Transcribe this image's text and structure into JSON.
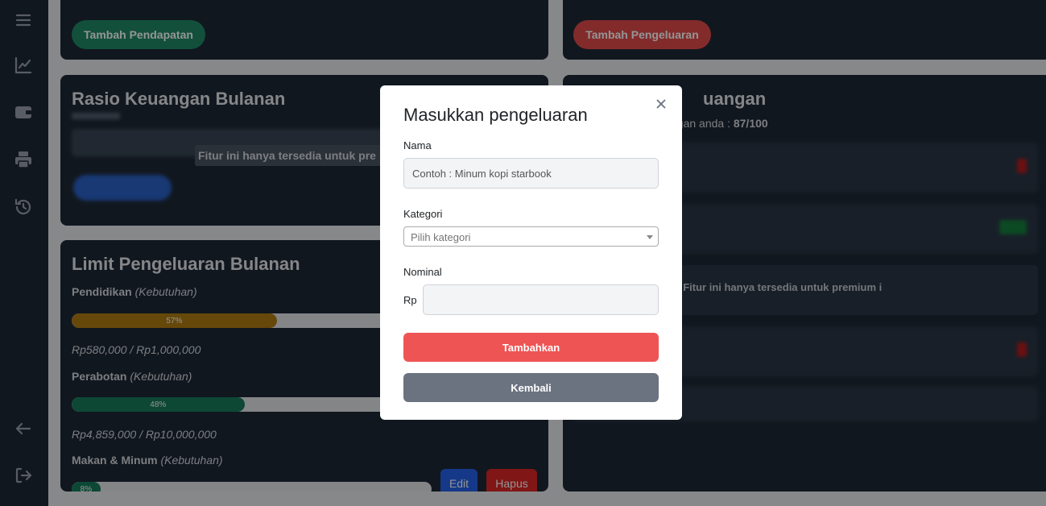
{
  "sidebar": {
    "icons": [
      "menu-icon",
      "chart-line-icon",
      "wallet-icon",
      "printer-icon",
      "history-icon",
      "arrow-left-icon",
      "logout-icon"
    ]
  },
  "income": {
    "add_label": "Tambah Pendapatan"
  },
  "expense": {
    "add_label": "Tambah Pengeluaran"
  },
  "ratio": {
    "title": "Rasio Keuangan Bulanan",
    "tooltip": "Fitur ini hanya tersedia untuk pre"
  },
  "health": {
    "title_fragment": "uangan",
    "score_prefix": "ngan anda : ",
    "score": "87/100",
    "premium_notice": "i Fitur ini hanya tersedia untuk premium i"
  },
  "limits": {
    "title": "Limit Pengeluaran Bulanan",
    "items": [
      {
        "name": "Pendidikan",
        "type": "(Kebutuhan)",
        "percent_label": "57%",
        "percent": 57,
        "color": "#b07d12",
        "amount": "Rp580,000 / Rp1,000,000"
      },
      {
        "name": "Perabotan",
        "type": "(Kebutuhan)",
        "percent_label": "48%",
        "percent": 48,
        "color": "#177d5c",
        "amount": "Rp4,859,000 / Rp10,000,000"
      },
      {
        "name": "Makan & Minum",
        "type": "(Kebutuhan)",
        "percent_label": "8%",
        "percent": 8,
        "color": "#177d5c"
      }
    ],
    "edit_label": "Edit",
    "delete_label": "Hapus"
  },
  "modal": {
    "title": "Masukkan pengeluaran",
    "name_label": "Nama",
    "name_placeholder": "Contoh : Minum kopi starbook",
    "category_label": "Kategori",
    "category_placeholder": "Pilih kategori",
    "nominal_label": "Nominal",
    "currency_prefix": "Rp",
    "submit_label": "Tambahkan",
    "back_label": "Kembali"
  },
  "colors": {
    "sidebar_bg": "#1e2936",
    "income_green": "#1f8a66",
    "expense_red": "#e24b4b",
    "submit_red": "#ef5454",
    "back_gray": "#6b7280",
    "edit_blue": "#2563eb",
    "delete_red": "#dc2626"
  }
}
